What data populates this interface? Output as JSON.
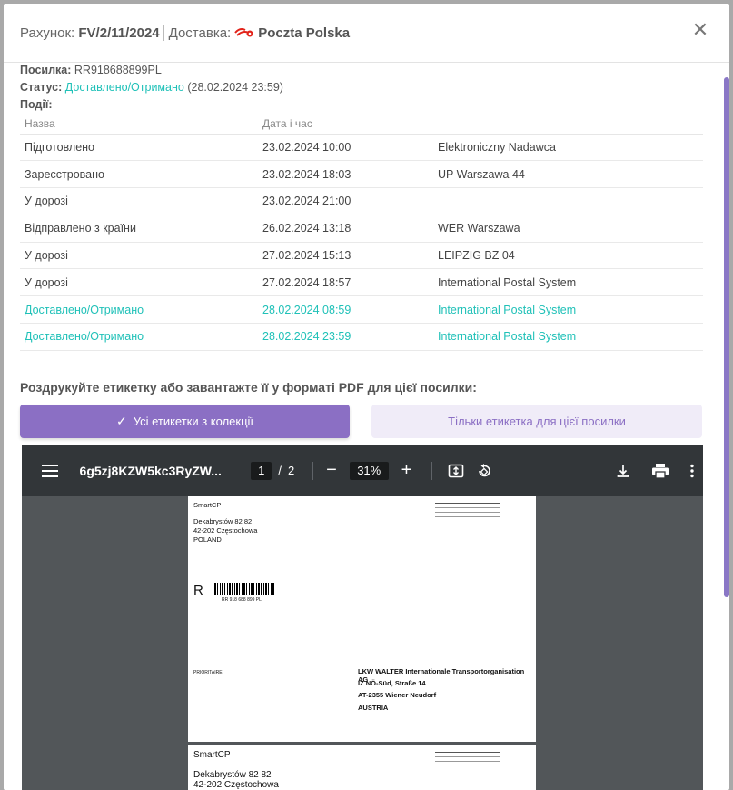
{
  "header": {
    "invoice_label": "Рахунок:",
    "invoice_number": "FV/2/11/2024",
    "delivery_label": "Доставка:",
    "carrier": "Poczta Polska"
  },
  "info": {
    "parcel_label": "Посилка:",
    "parcel_number": "RR918688899PL",
    "status_label": "Статус:",
    "status_value": "Доставлено/Отримано",
    "status_time": "(28.02.2024 23:59)",
    "events_label": "Події:"
  },
  "table": {
    "headers": [
      "Назва",
      "Дата і час",
      ""
    ],
    "rows": [
      {
        "name": "Підготовлено",
        "datetime": "23.02.2024 10:00",
        "place": "Elektroniczny Nadawca"
      },
      {
        "name": "Зареєстровано",
        "datetime": "23.02.2024 18:03",
        "place": "UP Warszawa 44"
      },
      {
        "name": "У дорозі",
        "datetime": "23.02.2024 21:00",
        "place": ""
      },
      {
        "name": "Відправлено з країни",
        "datetime": "26.02.2024 13:18",
        "place": "WER Warszawa"
      },
      {
        "name": "У дорозі",
        "datetime": "27.02.2024 15:13",
        "place": "LEIPZIG BZ 04"
      },
      {
        "name": "У дорозі",
        "datetime": "27.02.2024 18:57",
        "place": "International Postal System"
      },
      {
        "name": "Доставлено/Отримано",
        "datetime": "28.02.2024 08:59",
        "place": "International Postal System"
      },
      {
        "name": "Доставлено/Отримано",
        "datetime": "28.02.2024 23:59",
        "place": "International Postal System"
      }
    ]
  },
  "print": {
    "title": "Роздрукуйте етикетку або завантажте її у форматі PDF для цієї посилки:",
    "all_labels_button": "Усі етикетки з колекції",
    "single_label_button": "Тільки етикетка для цієї посилки"
  },
  "pdf": {
    "title": "6g5zj8KZW5kc3RyZW...",
    "page": "1",
    "page_sep": "/",
    "total_pages": "2",
    "zoom": "31%",
    "label1": {
      "sender_name": "SmartCP",
      "sender_street": "Dekabrystów 82 82",
      "sender_city": "42-202 Częstochowa",
      "sender_country": "POLAND",
      "r_mark": "R",
      "barcode_text": "RR 918 688 899 PL",
      "priority": "PRIORITAIRE",
      "recipient_name": "LKW WALTER Internationale Transportorganisation AG",
      "recipient_street": "IZ NÖ-Süd, Straße 14",
      "recipient_city": "AT-2355 Wiener Neudorf",
      "recipient_country": "AUSTRIA"
    },
    "label2": {
      "sender_name": "SmartCP",
      "sender_street": "Dekabrystów 82 82",
      "sender_city": "42-202 Częstochowa"
    }
  },
  "colors": {
    "accent": "#8b6fc4",
    "teal": "#20c1b8",
    "pdf_toolbar": "#323639",
    "pdf_bg": "#525659"
  }
}
